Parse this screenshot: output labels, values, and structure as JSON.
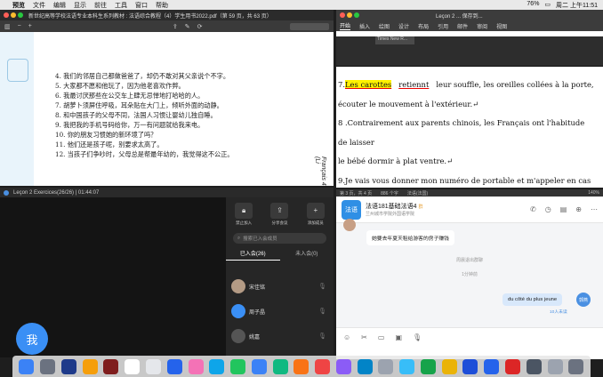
{
  "menubar": {
    "app": "预览",
    "items": [
      "文件",
      "编辑",
      "显示",
      "前往",
      "工具",
      "窗口",
      "帮助"
    ],
    "battery": "76%",
    "clock": "周二 上午11:51"
  },
  "pdf": {
    "title": "新世纪高等学校法语专业本科生系列教材 : 法语综合教程（4）学生用书2022.pdf（第 59 页，共 63 页）",
    "lines": [
      "4.  我们的邻居自己都做爸爸了，却仍不敢对其父亲说个不字。",
      "5.  大家都不愿和他玩了，因为他老喜欢作弊。",
      "6.  我最讨厌那些在公交车上肆无忌惮地打哈哈的人。",
      "7.  胡萝卜须屏住呼吸，耳朵贴在大门上，倾听外面的动静。",
      "8.  和中国孩子的父母不同，法国人习惯让婴幼儿独自睡。",
      "9.  我把我的手机号码给你，万一有问题就给我来电。",
      "10. 你的朋友习惯她的新环境了吗？",
      "11. 他们还是孩子呢，别要求太高了。",
      "12. 当孩子们争吵时，父母总是帮最年幼的，我觉得这不公正。"
    ],
    "side_vertical": "Français 4 (Li"
  },
  "word": {
    "title": "Leçon 2 ... 保存到...",
    "tabs": [
      "开始",
      "插入",
      "绘图",
      "设计",
      "布局",
      "引用",
      "邮件",
      "审阅",
      "视图"
    ],
    "font_name": "Times New R...",
    "doc_lines": {
      "l1_prefix": "7.",
      "l1_hl": "Les carottes",
      "l1_rest_ul": "retiennt",
      "l1_tail": "leur souffle, les oreilles collées à la porte,",
      "l2": "écouter le mouvement à l'extérieur.↵",
      "l3": "8 .Contrairement aux parents chinois, les Français ont l'habitude de laisser",
      "l4": "le bébé dormir à plat ventre.↵",
      "l5": "9.Je vais vous donner mon numéro de portable et m'appeler en cas de"
    },
    "status_page": "第 3 页，共 4 页",
    "status_words": "886 个字",
    "status_lang": "法语(法国)",
    "zoom": "140%"
  },
  "meeting": {
    "title": "Leçon 2 Exercices(26/26) | 01:44:07",
    "me_label": "我",
    "panel_buttons": [
      "禁止加入",
      "分享会议",
      "添加成员"
    ],
    "search_placeholder": "搜索已入会成员",
    "tab_joined": "已入会(26)",
    "tab_notjoined": "未入会(0)",
    "members": [
      "宋佳铭",
      "周子晶",
      "姚嘉"
    ]
  },
  "chat": {
    "group_name": "法语181基础法语4",
    "group_badge": "群",
    "group_sub": "兰州城市学院外国语学院",
    "avatar_text": "法语",
    "message_in": "她要去年夏天租给游客的房子赚钱",
    "sys1": "周晨退出群聊",
    "sys2": "1分钟前",
    "message_out": "du côté du plus jeune",
    "me_avatar": "郭燕",
    "read_count": "10人未读"
  }
}
